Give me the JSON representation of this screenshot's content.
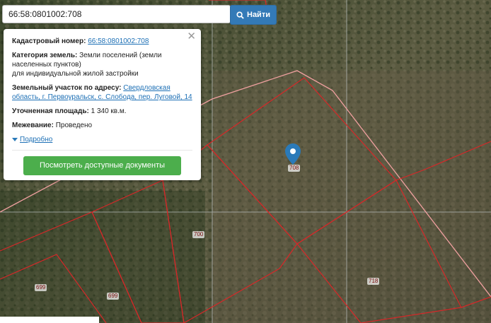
{
  "search": {
    "value": "66:58:0801002:708",
    "button_label": "Найти"
  },
  "popup": {
    "cadastral_label": "Кадастровый номер:",
    "cadastral_value": "66:58:0801002:708",
    "category_label": "Категория земель:",
    "category_value_1": "Земли поселений (земли",
    "category_value_2": "населенных пунктов)",
    "category_value_3": "для индивидуальной жилой застройки",
    "address_label": "Земельный участок по адресу:",
    "address_value_1": "Свердловская",
    "address_value_2": "область, г. Первоуральск, с. Слобода, пер. Луговой, 14",
    "area_label": "Уточненная площадь:",
    "area_value": "1 340 кв.м.",
    "survey_label": "Межевание:",
    "survey_value": "Проведено",
    "more_label": "Подробно",
    "docs_button_label": "Посмотреть доступные документы"
  },
  "map": {
    "plot_labels": [
      "708",
      "700",
      "699",
      "699",
      "718"
    ],
    "colors": {
      "boundary": "#d62728",
      "highlight": "#f0a0a0",
      "accent": "#337ab7",
      "button": "#4cae4c"
    }
  }
}
